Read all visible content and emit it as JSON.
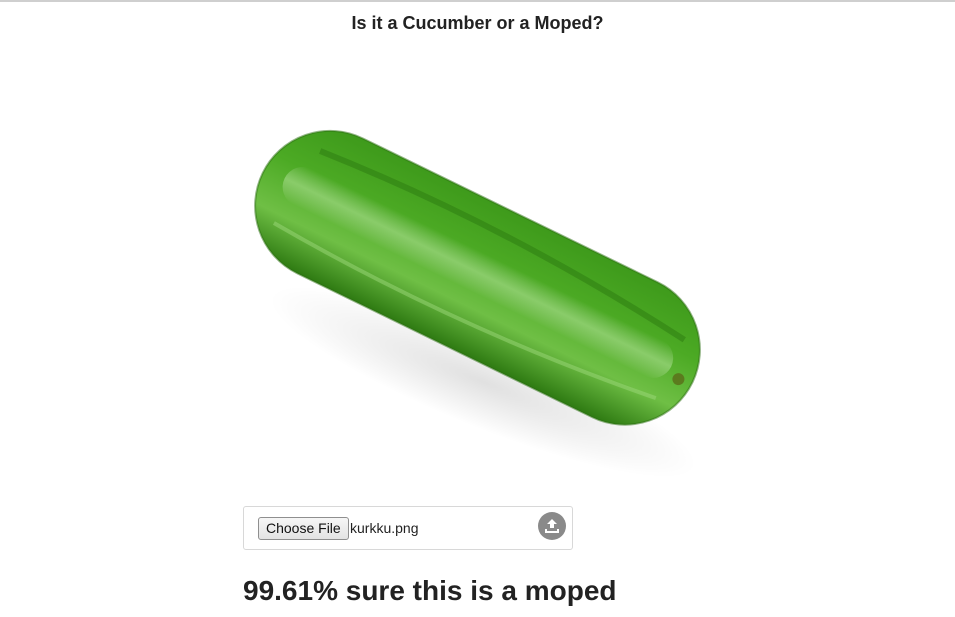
{
  "page": {
    "title": "Is it a Cucumber or a Moped?"
  },
  "image": {
    "subject_icon": "cucumber-photo",
    "colors": {
      "dark_green": "#2f7d16",
      "mid_green": "#3f9a1f",
      "light_green": "#6ec43a"
    }
  },
  "uploader": {
    "button_label": "Choose File",
    "file_name": "kurkku.png",
    "upload_icon": "upload-icon"
  },
  "result": {
    "text": "99.61% sure this is a moped"
  }
}
